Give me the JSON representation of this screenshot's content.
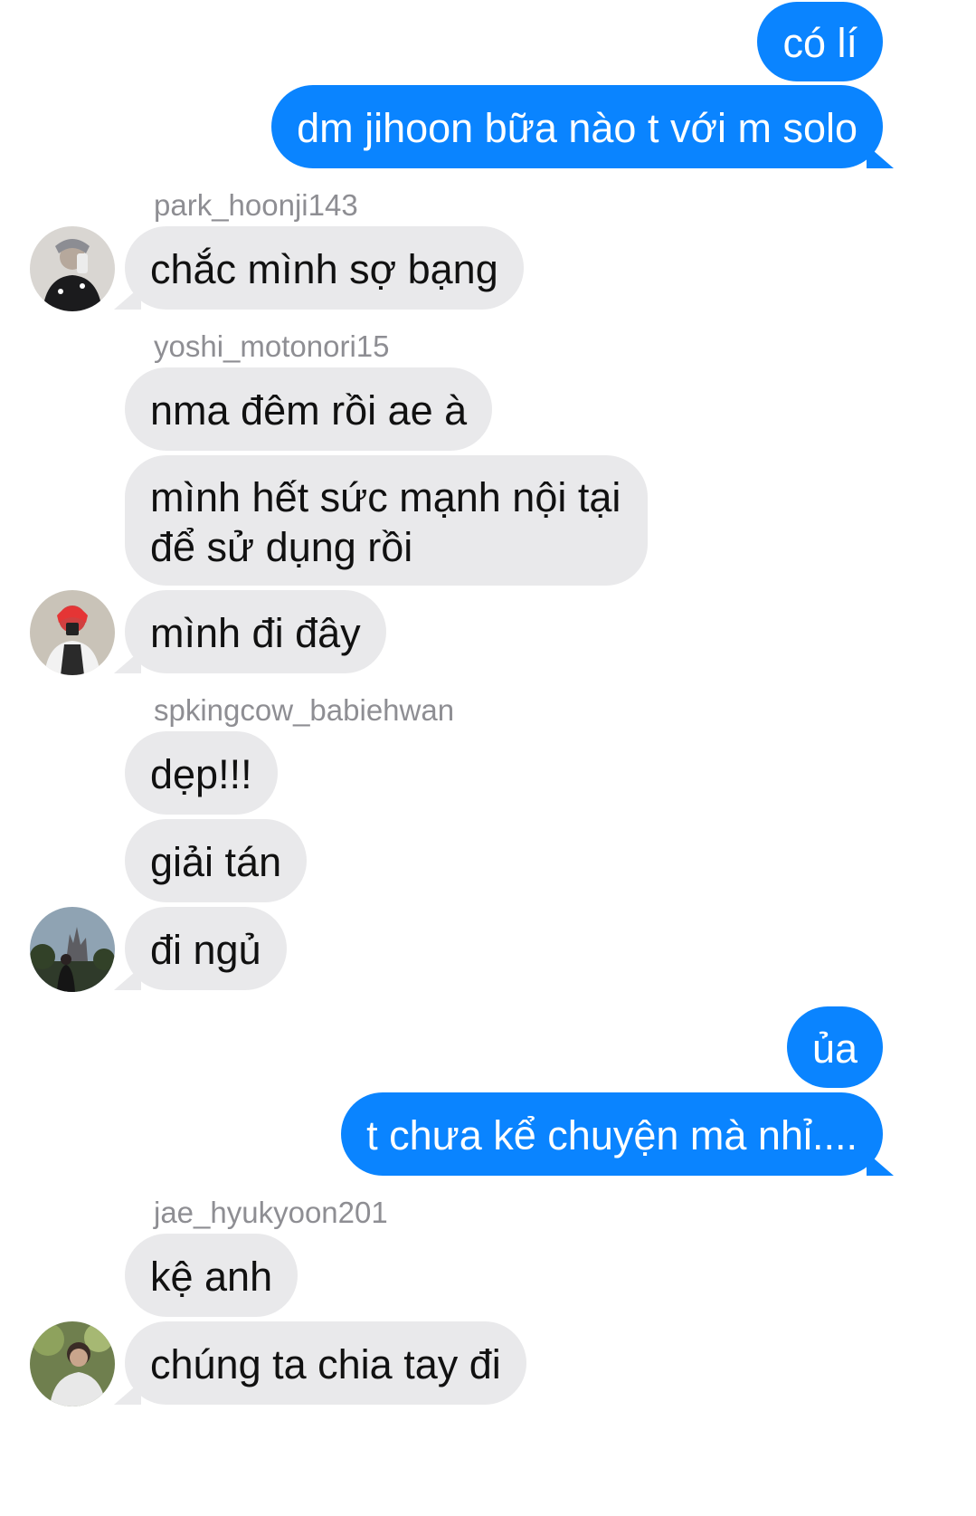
{
  "messages": [
    {
      "text": "có lí"
    },
    {
      "text": "dm jihoon bữa nào t với m solo"
    },
    {
      "text": "chắc mình sợ bạng"
    },
    {
      "text": "nma đêm rồi ae à"
    },
    {
      "text": "mình hết sức mạnh nội tại để sử dụng rồi"
    },
    {
      "text": "mình đi đây"
    },
    {
      "text": "dẹp!!!"
    },
    {
      "text": "giải tán"
    },
    {
      "text": "đi ngủ"
    },
    {
      "text": "ủa"
    },
    {
      "text": "t chưa kể chuyện mà nhỉ...."
    },
    {
      "text": "kệ anh"
    },
    {
      "text": "chúng ta chia tay đi"
    }
  ],
  "senders": {
    "park": "park_hoonji143",
    "yoshi": "yoshi_motonori15",
    "spking": "spkingcow_babiehwan",
    "jae": "jae_hyukyoon201"
  },
  "colors": {
    "outgoing_bubble": "#0a84ff",
    "incoming_bubble": "#e9e9eb",
    "sender_name": "#8e8e93"
  }
}
